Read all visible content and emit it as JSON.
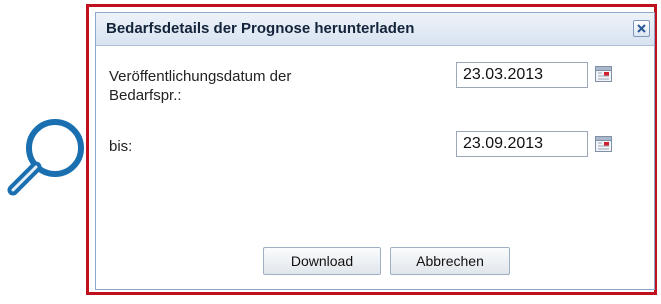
{
  "dialog": {
    "title": "Bedarfsdetails der Prognose herunterladen"
  },
  "fields": [
    {
      "label_line1": "Veröffentlichungsdatum der",
      "label_line2": "Bedarfspr.:",
      "value": "23.03.2013"
    },
    {
      "label_line1": "bis:",
      "value": "23.09.2013"
    }
  ],
  "buttons": {
    "download": "Download",
    "cancel": "Abbrechen"
  },
  "icons": {
    "magnifier": "magnifier-icon",
    "close": "close-icon",
    "calendar": "calendar-icon"
  },
  "colors": {
    "highlight_frame": "#c0101e",
    "magnifier": "#1a6fb0",
    "title_text": "#14243b"
  }
}
